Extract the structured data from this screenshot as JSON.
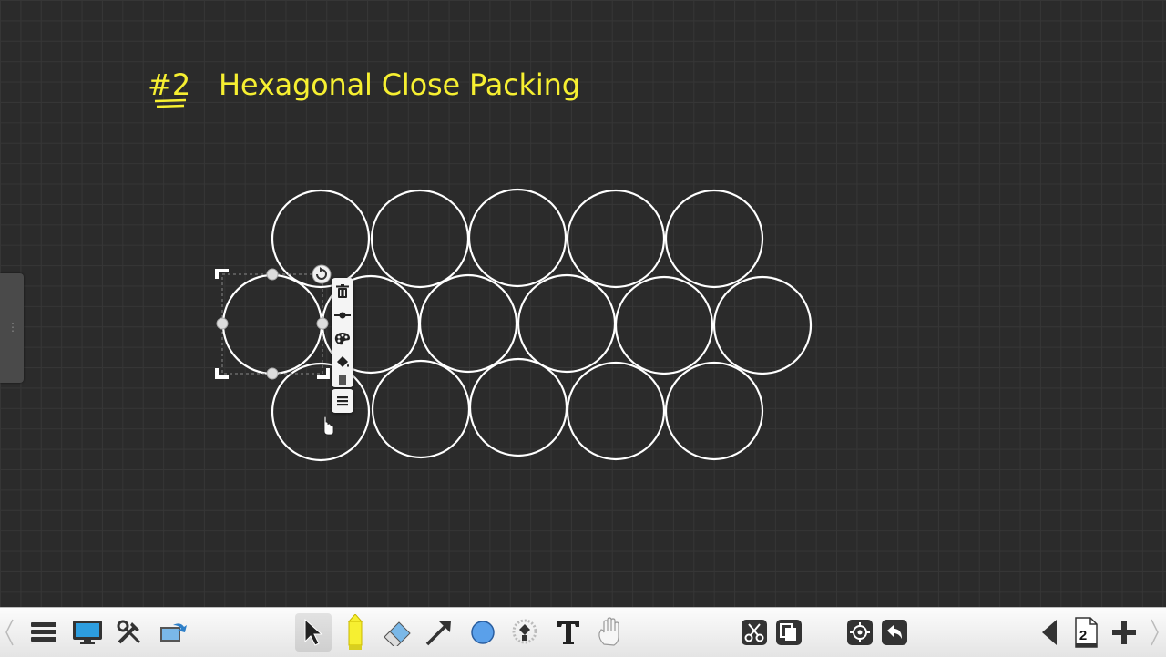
{
  "board": {
    "title_number": "#2",
    "title_text": "Hexagonal Close Packing",
    "ink_color": "#f6ef31",
    "circle_color": "#ffffff",
    "circle_count": 16
  },
  "object_menu": {
    "items": [
      "trash-icon",
      "line-style-icon",
      "palette-icon",
      "fill-bucket-icon",
      "menu-icon"
    ]
  },
  "toolbar": {
    "left_tools": [
      "menu-icon",
      "display-icon",
      "tools-icon",
      "share-icon"
    ],
    "center_tools": [
      "select-arrow-icon",
      "pen-icon",
      "eraser-icon",
      "line-arrow-icon",
      "shape-circle-icon",
      "fill-bucket-icon",
      "text-icon",
      "hand-icon"
    ],
    "right_tools": [
      "cut-icon",
      "duplicate-icon",
      "target-icon",
      "undo-icon"
    ],
    "page_number": "2"
  }
}
